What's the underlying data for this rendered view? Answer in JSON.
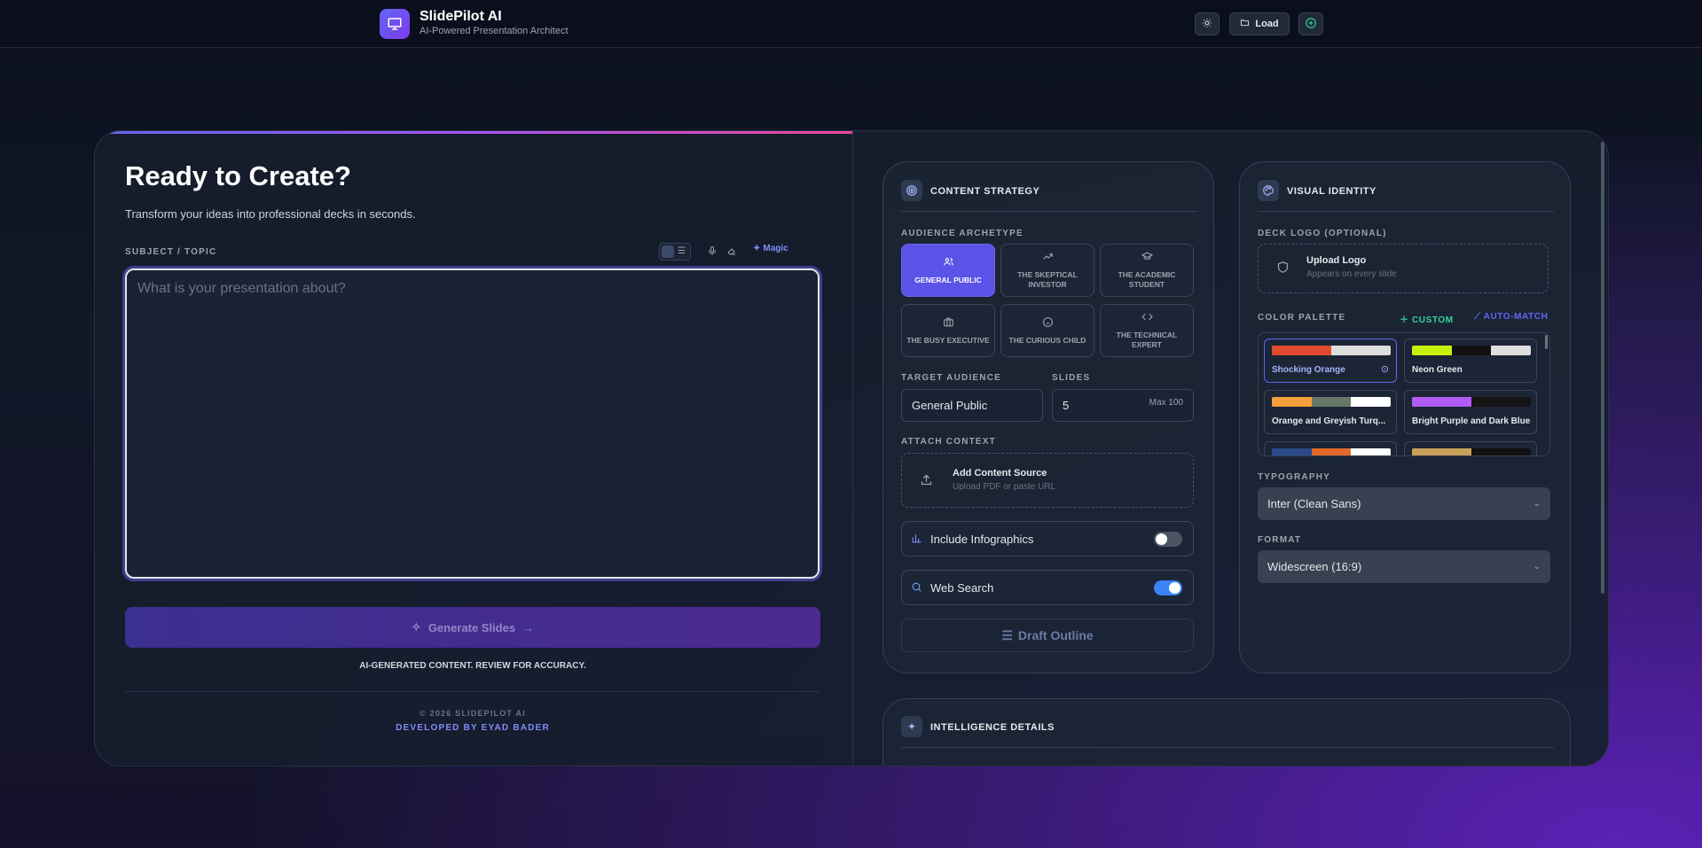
{
  "header": {
    "title": "SlidePilot AI",
    "subtitle": "AI-Powered Presentation Architect",
    "load_label": "Load"
  },
  "left": {
    "heading": "Ready to Create?",
    "subheading": "Transform your ideas into professional decks in seconds.",
    "topic_label": "SUBJECT / TOPIC",
    "magic_label": "Magic",
    "topic_placeholder": "What is your presentation about?",
    "generate_label": "Generate Slides",
    "disclaimer": "AI-GENERATED CONTENT. REVIEW FOR ACCURACY.",
    "copyright": "© 2026 SLIDEPILOT AI",
    "developer": "DEVELOPED BY EYAD BADER"
  },
  "strategy": {
    "title": "CONTENT STRATEGY",
    "archetype_label": "AUDIENCE ARCHETYPE",
    "archetypes": [
      {
        "label": "GENERAL PUBLIC",
        "icon": "users-icon"
      },
      {
        "label": "THE SKEPTICAL INVESTOR",
        "icon": "trend-icon"
      },
      {
        "label": "THE ACADEMIC STUDENT",
        "icon": "graduation-cap-icon"
      },
      {
        "label": "THE BUSY EXECUTIVE",
        "icon": "briefcase-icon"
      },
      {
        "label": "THE CURIOUS CHILD",
        "icon": "baby-icon"
      },
      {
        "label": "THE TECHNICAL EXPERT",
        "icon": "code-icon"
      }
    ],
    "target_label": "TARGET AUDIENCE",
    "target_value": "General Public",
    "slides_label": "SLIDES",
    "slides_value": "5",
    "slides_max": "Max 100",
    "attach_label": "ATTACH CONTEXT",
    "attach_title": "Add Content Source",
    "attach_sub": "Upload PDF or paste URL",
    "infographics_label": "Include Infographics",
    "infographics_on": false,
    "websearch_label": "Web Search",
    "websearch_on": true,
    "draft_label": "Draft Outline"
  },
  "visual": {
    "title": "VISUAL IDENTITY",
    "logo_label": "DECK LOGO (OPTIONAL)",
    "upload_title": "Upload Logo",
    "upload_sub": "Appears on every slide",
    "palette_label": "COLOR PALETTE",
    "custom_label": "CUSTOM",
    "automatch_label": "AUTO-MATCH",
    "palettes": [
      {
        "name": "Shocking Orange",
        "colors": [
          "#e04a2f",
          "#e04a2f",
          "#dedede",
          "#dedede"
        ],
        "selected": true
      },
      {
        "name": "Neon Green",
        "colors": [
          "#c9f00a",
          "#111111",
          "#dedede",
          "#dedede"
        ],
        "selected": false
      },
      {
        "name": "Orange and Greyish Turq...",
        "colors": [
          "#f59e3b",
          "#667766",
          "#667766",
          "#ffffff"
        ],
        "selected": false
      },
      {
        "name": "Bright Purple and Dark Blue",
        "colors": [
          "#b15cf5",
          "#b15cf5",
          "#151515",
          "#151515"
        ],
        "selected": false
      }
    ],
    "typography_label": "TYPOGRAPHY",
    "typography_value": "Inter (Clean Sans)",
    "format_label": "FORMAT",
    "format_value": "Widescreen (16:9)"
  },
  "intel": {
    "title": "INTELLIGENCE DETAILS"
  }
}
